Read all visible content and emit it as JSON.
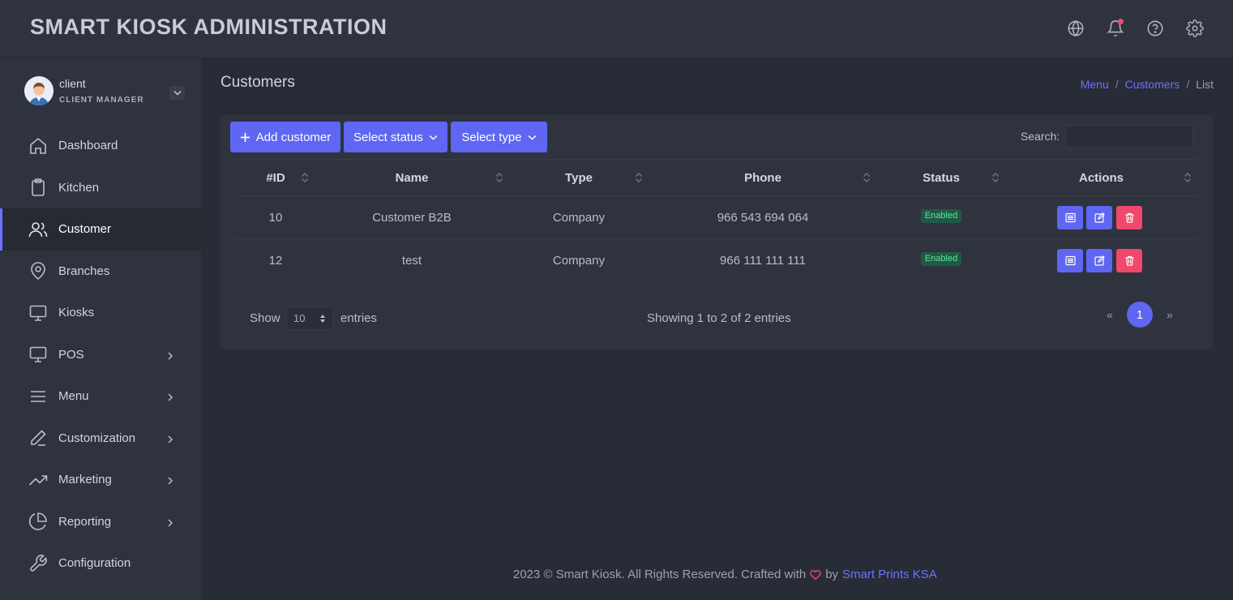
{
  "app": {
    "title": "SMART KIOSK ADMINISTRATION"
  },
  "header": {
    "icons": [
      "globe-icon",
      "bell-icon",
      "help-icon",
      "gear-icon"
    ],
    "notification_dot_color": "#f3476d"
  },
  "profile": {
    "name": "client",
    "role": "CLIENT MANAGER"
  },
  "sidebar": {
    "items": [
      {
        "label": "Dashboard",
        "icon": "home-icon",
        "has_submenu": false
      },
      {
        "label": "Kitchen",
        "icon": "clipboard-icon",
        "has_submenu": false
      },
      {
        "label": "Customer",
        "icon": "users-icon",
        "has_submenu": false,
        "active": true
      },
      {
        "label": "Branches",
        "icon": "map-pin-icon",
        "has_submenu": false
      },
      {
        "label": "Kiosks",
        "icon": "monitor-icon",
        "has_submenu": false
      },
      {
        "label": "POS",
        "icon": "monitor-icon",
        "has_submenu": true
      },
      {
        "label": "Menu",
        "icon": "menu-icon",
        "has_submenu": true
      },
      {
        "label": "Customization",
        "icon": "pen-icon",
        "has_submenu": true
      },
      {
        "label": "Marketing",
        "icon": "trending-up-icon",
        "has_submenu": true
      },
      {
        "label": "Reporting",
        "icon": "pie-chart-icon",
        "has_submenu": true
      },
      {
        "label": "Configuration",
        "icon": "wrench-icon",
        "has_submenu": false
      }
    ]
  },
  "page": {
    "title": "Customers",
    "breadcrumb": {
      "menu": "Menu",
      "customers": "Customers",
      "current": "List",
      "separator": "/"
    }
  },
  "toolbar": {
    "add_label": "Add customer",
    "status_label": "Select status",
    "type_label": "Select type",
    "search_label": "Search:",
    "search_value": ""
  },
  "table": {
    "columns": [
      "#ID",
      "Name",
      "Type",
      "Phone",
      "Status",
      "Actions"
    ],
    "rows": [
      {
        "id": "10",
        "name": "Customer B2B",
        "type": "Company",
        "phone": "966 543 694 064",
        "status": "Enabled"
      },
      {
        "id": "12",
        "name": "test",
        "type": "Company",
        "phone": "966 111 111 111",
        "status": "Enabled"
      }
    ]
  },
  "pagination": {
    "show_label": "Show",
    "page_length": "10",
    "entries_label": "entries",
    "info": "Showing 1 to 2 of 2 entries",
    "prev": "«",
    "current": "1",
    "next": "»"
  },
  "footer": {
    "text": "2023 © Smart Kiosk. All Rights Reserved. Crafted with",
    "by": "by",
    "link": "Smart Prints KSA"
  },
  "colors": {
    "accent": "#5f66f2",
    "danger": "#f1476b",
    "success_badge": "#5fe2a3",
    "background": "#282c36",
    "panel": "#2f333e"
  }
}
